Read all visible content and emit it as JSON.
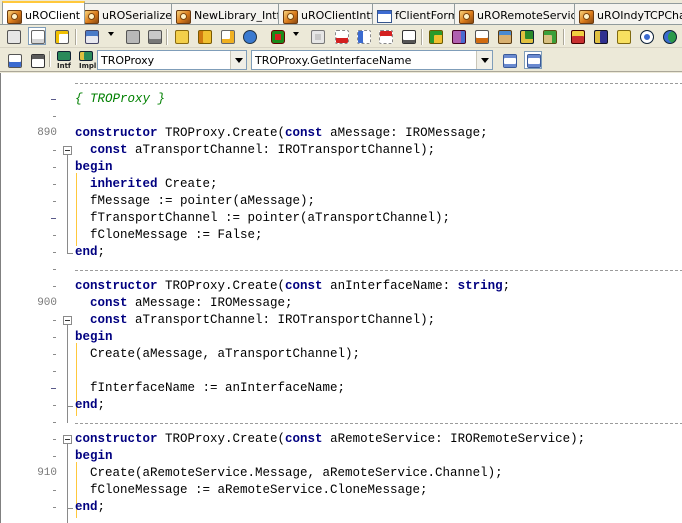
{
  "tabs": [
    {
      "label": "uROClient",
      "icon": "unit-icon",
      "active": true
    },
    {
      "label": "uROSerializer",
      "icon": "unit-icon",
      "active": false
    },
    {
      "label": "NewLibrary_Intf",
      "icon": "unit-icon",
      "active": false
    },
    {
      "label": "uROClientIntf",
      "icon": "unit-icon",
      "active": false
    },
    {
      "label": "fClientForm",
      "icon": "form-icon",
      "active": false
    },
    {
      "label": "uRORemoteService",
      "icon": "unit-icon",
      "active": false
    },
    {
      "label": "uROIndyTCPChan",
      "icon": "unit-icon",
      "active": false
    }
  ],
  "toolbar2": {
    "intf_label": "Intf",
    "impl_label": "Impl",
    "class_combo_value": "TROProxy",
    "method_combo_value": "TROProxy.GetInterfaceName"
  },
  "editor": {
    "lines": [
      {
        "num": "",
        "marker": "dash",
        "fold": "",
        "segments": [
          {
            "t": "{ TROProxy }",
            "c": "cm"
          }
        ]
      },
      {
        "num": "",
        "marker": "tick",
        "fold": "",
        "segments": []
      },
      {
        "num": "890",
        "marker": "",
        "fold": "",
        "segments": [
          {
            "t": "constructor",
            "c": "kw"
          },
          {
            "t": " TROProxy.Create(",
            "c": ""
          },
          {
            "t": "const",
            "c": "kw"
          },
          {
            "t": " aMessage: IROMessage;",
            "c": ""
          }
        ]
      },
      {
        "num": "",
        "marker": "tick",
        "fold": "box",
        "segments": [
          {
            "t": "  ",
            "c": ""
          },
          {
            "t": "const",
            "c": "kw"
          },
          {
            "t": " aTransportChannel: IROTransportChannel);",
            "c": ""
          }
        ]
      },
      {
        "num": "",
        "marker": "tick",
        "fold": "",
        "segments": [
          {
            "t": "begin",
            "c": "kw"
          }
        ]
      },
      {
        "num": "",
        "marker": "tick",
        "fold": "",
        "segments": [
          {
            "t": "  ",
            "c": ""
          },
          {
            "t": "inherited",
            "c": "kw"
          },
          {
            "t": " Create;",
            "c": ""
          }
        ]
      },
      {
        "num": "",
        "marker": "tick",
        "fold": "",
        "segments": [
          {
            "t": "  fMessage := pointer(aMessage);",
            "c": ""
          }
        ]
      },
      {
        "num": "",
        "marker": "dash",
        "fold": "",
        "segments": [
          {
            "t": "  fTransportChannel := pointer(aTransportChannel);",
            "c": ""
          }
        ]
      },
      {
        "num": "",
        "marker": "tick",
        "fold": "",
        "segments": [
          {
            "t": "  fCloneMessage := False;",
            "c": ""
          }
        ]
      },
      {
        "num": "",
        "marker": "tick",
        "fold": "end",
        "segments": [
          {
            "t": "end",
            "c": "kw"
          },
          {
            "t": ";",
            "c": ""
          }
        ]
      },
      {
        "num": "",
        "marker": "tick",
        "fold": "",
        "segments": []
      },
      {
        "num": "",
        "marker": "tick",
        "fold": "",
        "segments": [
          {
            "t": "constructor",
            "c": "kw"
          },
          {
            "t": " TROProxy.Create(",
            "c": ""
          },
          {
            "t": "const",
            "c": "kw"
          },
          {
            "t": " anInterfaceName: ",
            "c": ""
          },
          {
            "t": "string",
            "c": "kw"
          },
          {
            "t": ";",
            "c": ""
          }
        ]
      },
      {
        "num": "900",
        "marker": "",
        "fold": "",
        "segments": [
          {
            "t": "  ",
            "c": ""
          },
          {
            "t": "const",
            "c": "kw"
          },
          {
            "t": " aMessage: IROMessage;",
            "c": ""
          }
        ]
      },
      {
        "num": "",
        "marker": "tick",
        "fold": "box",
        "segments": [
          {
            "t": "  ",
            "c": ""
          },
          {
            "t": "const",
            "c": "kw"
          },
          {
            "t": " aTransportChannel: IROTransportChannel);",
            "c": ""
          }
        ]
      },
      {
        "num": "",
        "marker": "tick",
        "fold": "",
        "segments": [
          {
            "t": "begin",
            "c": "kw"
          }
        ]
      },
      {
        "num": "",
        "marker": "tick",
        "fold": "",
        "segments": [
          {
            "t": "  Create(aMessage, aTransportChannel);",
            "c": ""
          }
        ]
      },
      {
        "num": "",
        "marker": "tick",
        "fold": "",
        "segments": []
      },
      {
        "num": "",
        "marker": "dash",
        "fold": "",
        "segments": [
          {
            "t": "  fInterfaceName := anInterfaceName;",
            "c": ""
          }
        ]
      },
      {
        "num": "",
        "marker": "tick",
        "fold": "end",
        "segments": [
          {
            "t": "end",
            "c": "kw"
          },
          {
            "t": ";",
            "c": ""
          }
        ]
      },
      {
        "num": "",
        "marker": "tick",
        "fold": "",
        "segments": []
      },
      {
        "num": "",
        "marker": "tick",
        "fold": "box",
        "segments": [
          {
            "t": "constructor",
            "c": "kw"
          },
          {
            "t": " TROProxy.Create(",
            "c": ""
          },
          {
            "t": "const",
            "c": "kw"
          },
          {
            "t": " aRemoteService: IRORemoteService);",
            "c": ""
          }
        ]
      },
      {
        "num": "",
        "marker": "tick",
        "fold": "",
        "segments": [
          {
            "t": "begin",
            "c": "kw"
          }
        ]
      },
      {
        "num": "910",
        "marker": "",
        "fold": "",
        "segments": [
          {
            "t": "  Create(aRemoteService.Message, aRemoteService.Channel);",
            "c": ""
          }
        ]
      },
      {
        "num": "",
        "marker": "tick",
        "fold": "",
        "segments": [
          {
            "t": "  fCloneMessage := aRemoteService.CloneMessage;",
            "c": ""
          }
        ]
      },
      {
        "num": "",
        "marker": "tick",
        "fold": "end",
        "segments": [
          {
            "t": "end",
            "c": "kw"
          },
          {
            "t": ";",
            "c": ""
          }
        ]
      },
      {
        "num": "",
        "marker": "tick",
        "fold": "",
        "segments": []
      }
    ]
  },
  "colors": {
    "keyword": "#000080",
    "comment": "#008000",
    "line_number": "#7a7a7a",
    "active_tab_accent": "#ffc83c"
  }
}
